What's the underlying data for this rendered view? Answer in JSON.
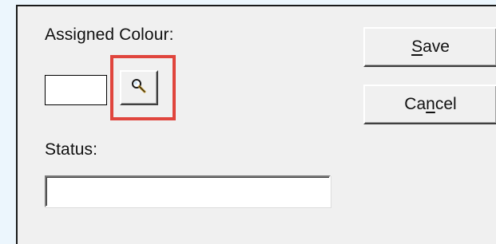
{
  "form": {
    "assigned_colour_label": "Assigned Colour:",
    "assigned_colour_value": "",
    "status_label": "Status:",
    "status_value": "",
    "lookup_icon": "magnifier-icon"
  },
  "buttons": {
    "save": {
      "mnemonic": "S",
      "rest": "ave"
    },
    "cancel": {
      "prefix": "Ca",
      "mnemonic": "n",
      "rest": "cel"
    }
  },
  "colors": {
    "highlight": "#e0453d",
    "page_background": "#ecf6fd",
    "dialog_background": "#f0f0f0"
  }
}
